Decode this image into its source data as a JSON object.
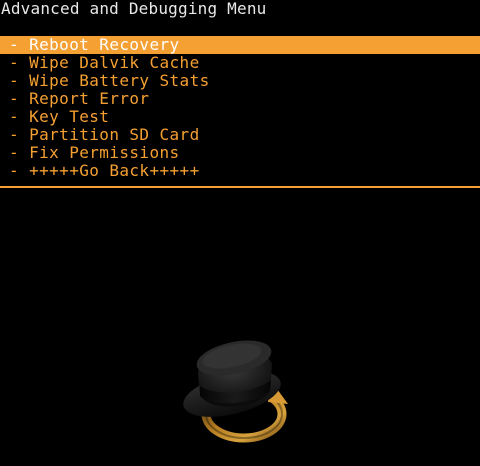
{
  "header": {
    "title": "Advanced and Debugging Menu"
  },
  "menu": {
    "items": [
      {
        "label": "- Reboot Recovery",
        "selected": true
      },
      {
        "label": "- Wipe Dalvik Cache",
        "selected": false
      },
      {
        "label": "- Wipe Battery Stats",
        "selected": false
      },
      {
        "label": "- Report Error",
        "selected": false
      },
      {
        "label": "- Key Test",
        "selected": false
      },
      {
        "label": "- Partition SD Card",
        "selected": false
      },
      {
        "label": "- Fix Permissions",
        "selected": false
      },
      {
        "label": "- +++++Go Back+++++",
        "selected": false
      }
    ]
  },
  "theme": {
    "accent": "#f5a032",
    "background": "#000000",
    "title_color": "#e8e8e8",
    "selected_text": "#ffffff"
  },
  "logo": {
    "icon": "clockworkmod-hat-logo-icon"
  }
}
